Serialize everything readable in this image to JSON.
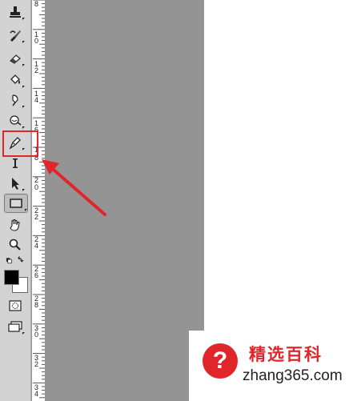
{
  "toolbar": {
    "tools": [
      {
        "name": "stamp-icon"
      },
      {
        "name": "history-brush-icon"
      },
      {
        "name": "eraser-icon"
      },
      {
        "name": "paint-bucket-icon"
      },
      {
        "name": "blur-icon"
      },
      {
        "name": "dodge-icon"
      },
      {
        "name": "pen-icon",
        "highlighted": true
      },
      {
        "name": "type-icon"
      },
      {
        "name": "path-selection-icon"
      },
      {
        "name": "rectangle-icon",
        "active": true
      },
      {
        "name": "hand-icon"
      },
      {
        "name": "zoom-icon"
      }
    ],
    "foreground_color": "#000000",
    "background_color": "#ffffff"
  },
  "ruler": {
    "labels": [
      "8",
      "1",
      "0",
      "1",
      "2",
      "1",
      "4",
      "1",
      "6",
      "1",
      "8",
      "2",
      "0",
      "2",
      "2",
      "2",
      "4",
      "2",
      "6",
      "2",
      "8",
      "3",
      "0",
      "3",
      "2",
      "3",
      "4"
    ]
  },
  "canvas": {
    "color": "#949494"
  },
  "annotation": {
    "color": "#e0262b"
  },
  "watermark": {
    "icon": "?",
    "title": "精选百科",
    "url": "zhang365.com"
  }
}
